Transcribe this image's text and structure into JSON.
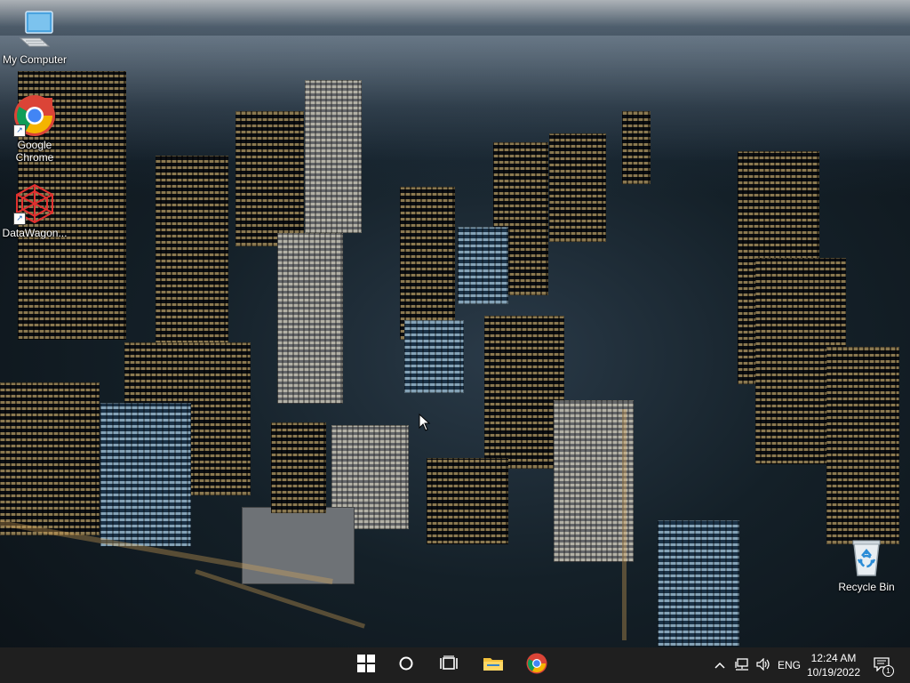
{
  "desktop": {
    "icons": [
      {
        "label": "My Computer",
        "icon": "computer-icon"
      },
      {
        "label": "Google Chrome",
        "icon": "chrome-icon"
      },
      {
        "label": "DataWagon...",
        "icon": "datawagon-icon"
      },
      {
        "label": "Recycle Bin",
        "icon": "recycle-bin-icon"
      }
    ]
  },
  "taskbar": {
    "start": {
      "icon": "windows-start-icon"
    },
    "search": {
      "icon": "search-circle-icon"
    },
    "task_view": {
      "icon": "task-view-icon"
    },
    "pinned": [
      {
        "name": "File Explorer",
        "icon": "folder-icon"
      },
      {
        "name": "Google Chrome",
        "icon": "chrome-icon"
      }
    ],
    "tray": {
      "chevron": {
        "icon": "chevron-up-icon"
      },
      "network": {
        "icon": "network-icon"
      },
      "volume": {
        "icon": "volume-icon"
      },
      "language": "ENG",
      "time": "12:24 AM",
      "date": "10/19/2022",
      "notifications": {
        "icon": "notification-icon",
        "count": "1"
      }
    }
  },
  "colors": {
    "taskbar_bg": "#1f1f1f",
    "accent_blue": "#0078d4",
    "folder_yellow": "#f4c23c"
  }
}
